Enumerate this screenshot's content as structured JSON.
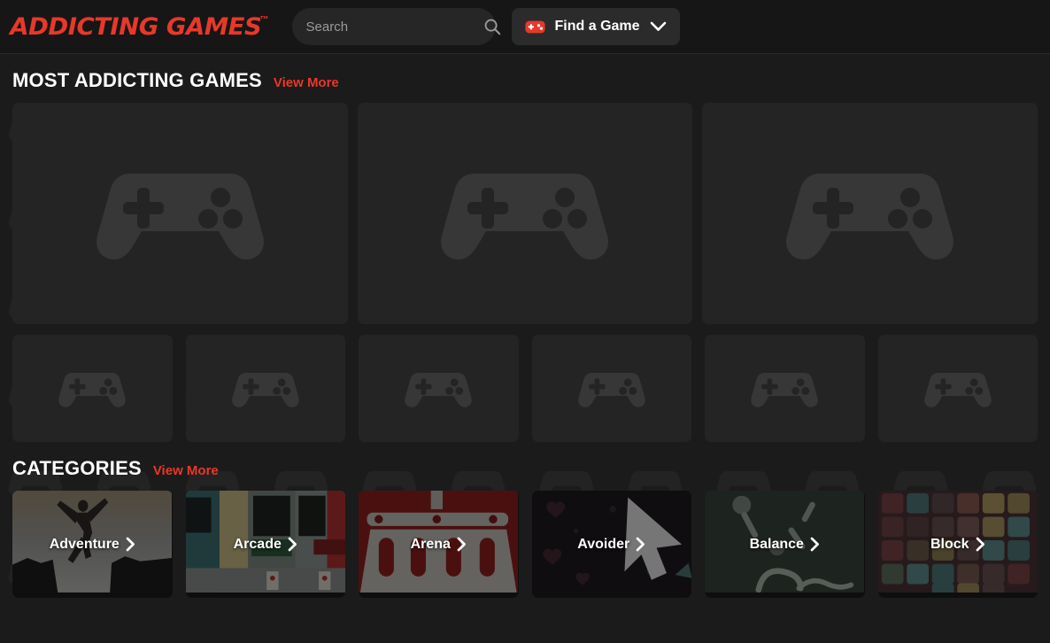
{
  "header": {
    "logo_text": "ADDICTING GAMES",
    "logo_tm": "™",
    "logo_color": "#e8382a",
    "search": {
      "value": "",
      "placeholder": "Search",
      "icon": "search-icon"
    },
    "find_game": {
      "label": "Find a Game",
      "icon": "gamepad-icon",
      "chevron": "chevron-down-icon"
    }
  },
  "sections": [
    {
      "title": "MOST ADDICTING GAMES",
      "view_more": "View More"
    },
    {
      "title": "CATEGORIES",
      "view_more": "View More"
    }
  ],
  "featured_games": {
    "placeholder_icon": "gamepad-placeholder-icon",
    "big_cards": [
      {
        "label": ""
      },
      {
        "label": ""
      },
      {
        "label": ""
      }
    ],
    "small_cards": [
      {
        "label": ""
      },
      {
        "label": ""
      },
      {
        "label": ""
      },
      {
        "label": ""
      },
      {
        "label": ""
      },
      {
        "label": ""
      }
    ]
  },
  "categories": [
    {
      "label": "Adventure",
      "chevron": "chevron-right-icon",
      "art": "silhouette-jumping-cliff"
    },
    {
      "label": "Arcade",
      "chevron": "chevron-right-icon",
      "art": "arcade-cabinets"
    },
    {
      "label": "Arena",
      "chevron": "chevron-right-icon",
      "art": "red-gladiator-helmet"
    },
    {
      "label": "Avoider",
      "chevron": "chevron-right-icon",
      "art": "cursor-arrow-dark"
    },
    {
      "label": "Balance",
      "chevron": "chevron-right-icon",
      "art": "green-balance-shapes"
    },
    {
      "label": "Block",
      "chevron": "chevron-right-icon",
      "art": "colored-block-grid"
    }
  ],
  "colors": {
    "brand_red": "#e8382a",
    "page_bg": "#1b1b1b",
    "header_bg": "#161616",
    "card_bg": "#242424"
  }
}
